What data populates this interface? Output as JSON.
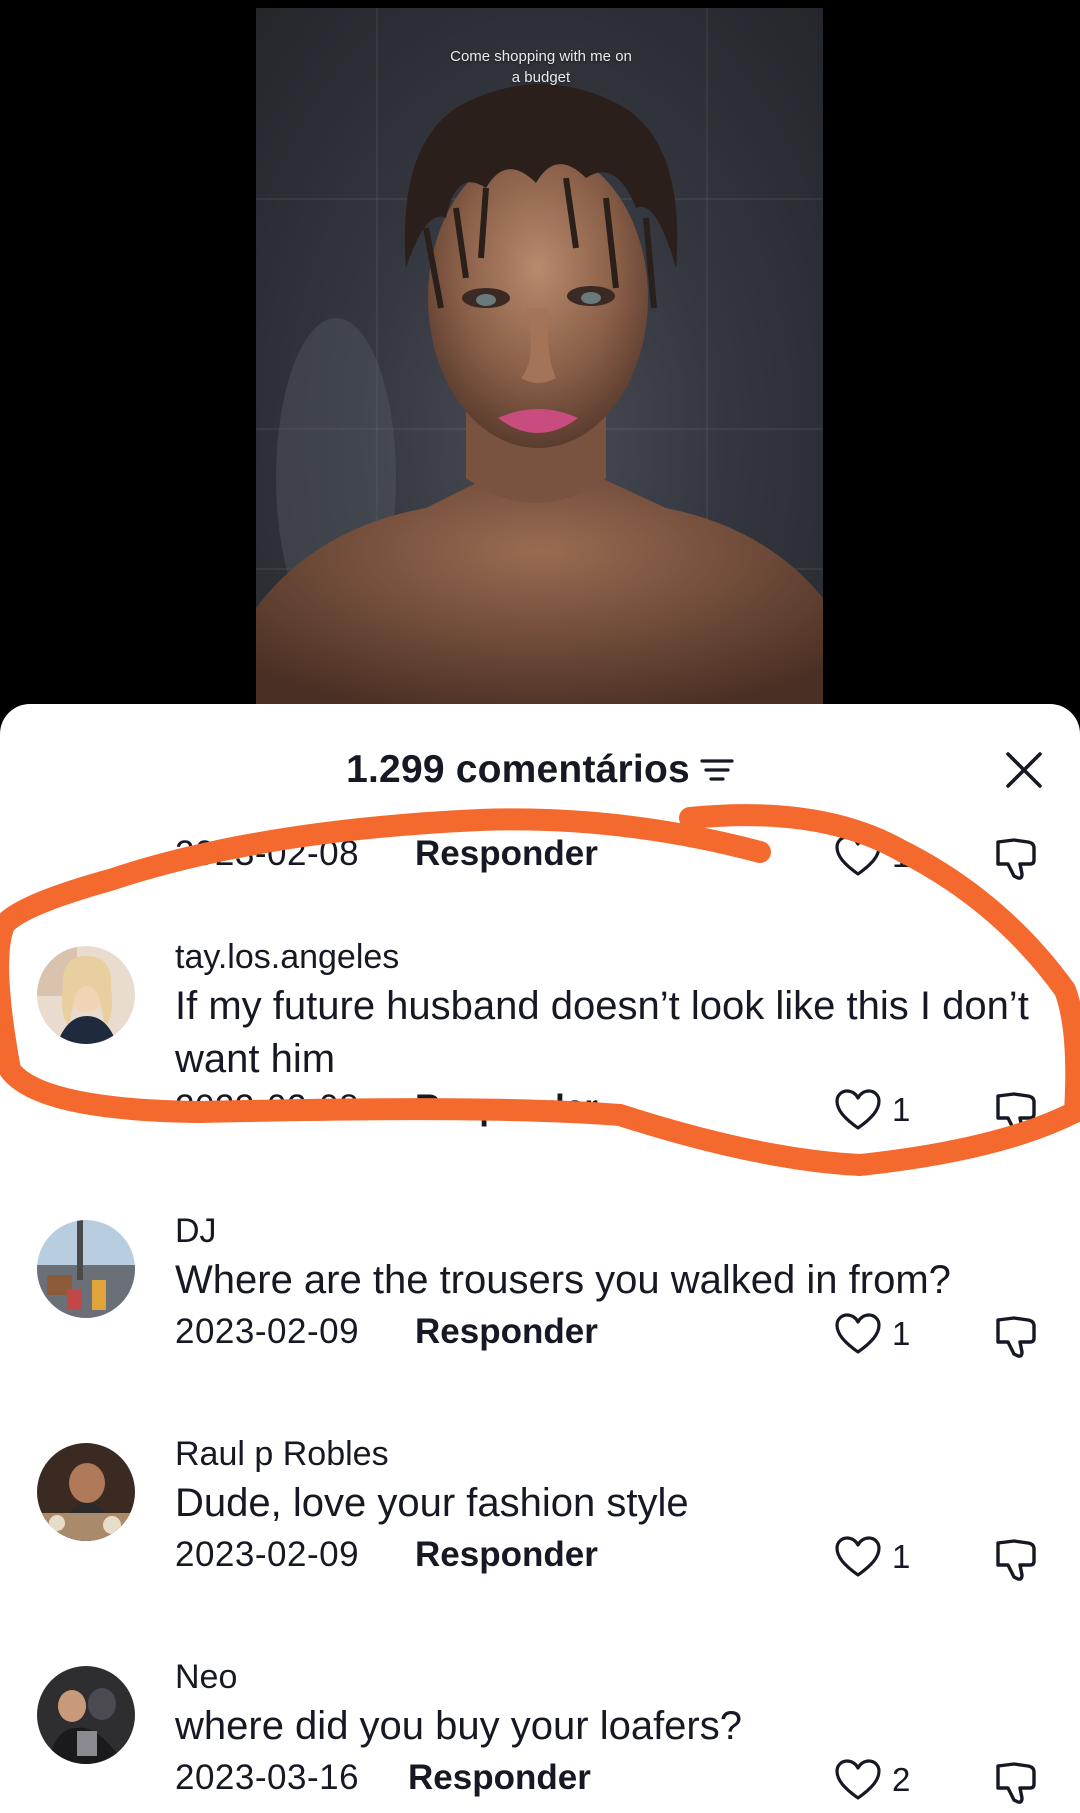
{
  "video": {
    "caption_line1": "Come shopping with me on",
    "caption_line2": "a budget"
  },
  "sheet": {
    "title": "1.299 comentários",
    "filter_icon": "filter-lines-icon",
    "close_icon": "close-x-icon"
  },
  "comments": [
    {
      "user": "",
      "text": "",
      "date": "2023-02-08",
      "reply": "Responder",
      "likes": "1"
    },
    {
      "user": "tay.los.angeles",
      "text": "If my future husband doesn’t look like this I don’t want him",
      "date": "2023-02-08",
      "reply": "Responder",
      "likes": "1"
    },
    {
      "user": "DJ",
      "text": "Where are the trousers you walked in from?",
      "date": "2023-02-09",
      "reply": "Responder",
      "likes": "1"
    },
    {
      "user": "Raul p Robles",
      "text": "Dude, love your fashion style",
      "date": "2023-02-09",
      "reply": "Responder",
      "likes": "1"
    },
    {
      "user": "Neo",
      "text": "where did you buy your loafers?",
      "date": "2023-03-16",
      "reply": "Responder",
      "likes": "2"
    }
  ],
  "colors": {
    "annotation_stroke": "#f46a2e",
    "text": "#161823"
  }
}
